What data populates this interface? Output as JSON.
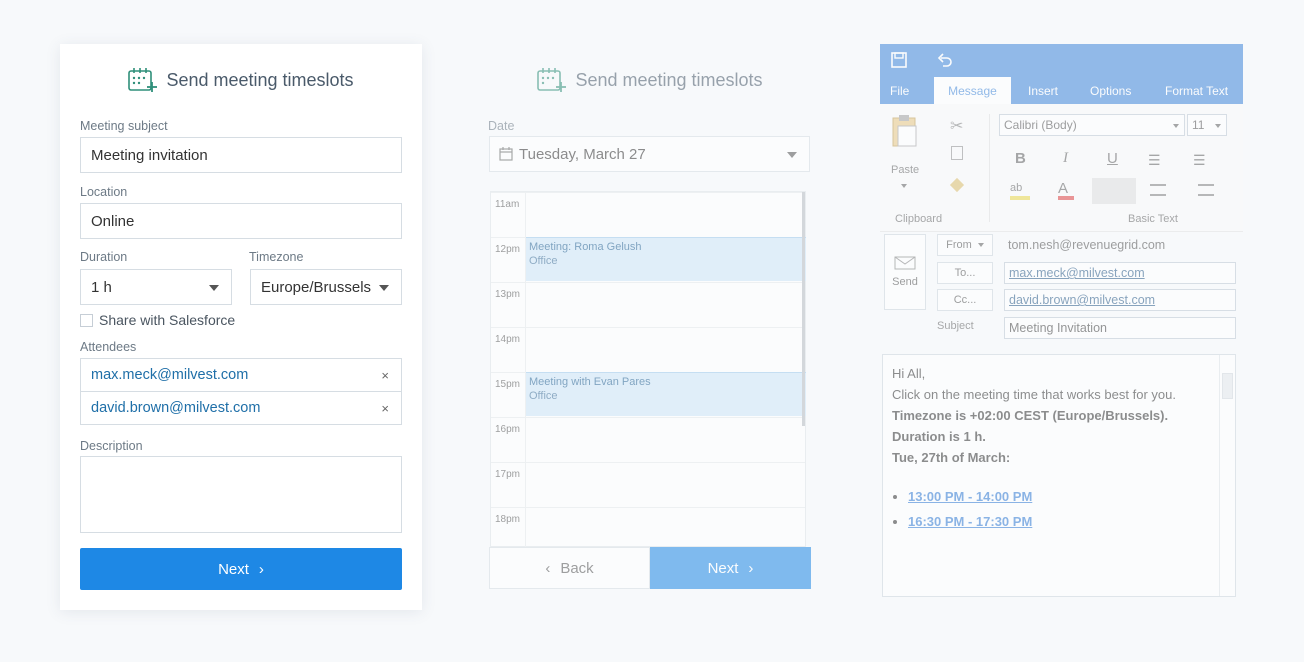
{
  "form": {
    "title": "Send meeting timeslots",
    "subject_label": "Meeting subject",
    "subject_value": "Meeting invitation",
    "location_label": "Location",
    "location_value": "Online",
    "duration_label": "Duration",
    "duration_value": "1 h",
    "timezone_label": "Timezone",
    "timezone_value": "Europe/Brussels",
    "share_label": "Share with Salesforce",
    "attendees_label": "Attendees",
    "attendees": [
      "max.meck@milvest.com",
      "david.brown@milvest.com"
    ],
    "remove_glyph": "×",
    "description_label": "Description",
    "next_label": "Next",
    "chevron": "›"
  },
  "calendar": {
    "title": "Send meeting timeslots",
    "date_label": "Date",
    "date_value": "Tuesday, March 27",
    "hours": [
      "11am",
      "12pm",
      "13pm",
      "14pm",
      "15pm",
      "16pm",
      "17pm",
      "18pm"
    ],
    "events": [
      {
        "title": "Meeting: Roma Gelush",
        "location": "Office"
      },
      {
        "title": "Meeting with Evan Pares",
        "location": "Office"
      }
    ],
    "back_label": "Back",
    "back_chevron": "‹",
    "next_label": "Next",
    "next_chevron": "›"
  },
  "outlook": {
    "tabs": [
      "File",
      "Message",
      "Insert",
      "Options",
      "Format Text"
    ],
    "paste_label": "Paste",
    "clipboard_label": "Clipboard",
    "font_name": "Calibri (Body)",
    "font_size": "11",
    "basic_text_label": "Basic Text",
    "send_label": "Send",
    "from_label": "From",
    "from_value": "tom.nesh@revenuegrid.com",
    "to_label": "To...",
    "to_value": "max.meck@milvest.com",
    "cc_label": "Cc...",
    "cc_value": "david.brown@milvest.com",
    "subject_label": "Subject",
    "subject_value": "Meeting Invitation",
    "body": {
      "greeting": "Hi All,",
      "line1": "Click on the meeting time that works best for you.",
      "timezone": "Timezone is +02:00 CEST (Europe/Brussels).",
      "duration": "Duration is 1 h.",
      "day": "Tue, 27th of March:",
      "slots": [
        "13:00 PM - 14:00 PM",
        "16:30 PM - 17:30 PM"
      ]
    }
  },
  "colors": {
    "primary": "#1e88e5",
    "event": "#cfe6f8",
    "outlook_blue": "#2e7bd6"
  },
  "icons": [
    "calendar-add-icon",
    "chevron-down-icon",
    "close-icon",
    "calendar-icon",
    "save-icon",
    "undo-icon",
    "clipboard-icon",
    "send-icon"
  ]
}
